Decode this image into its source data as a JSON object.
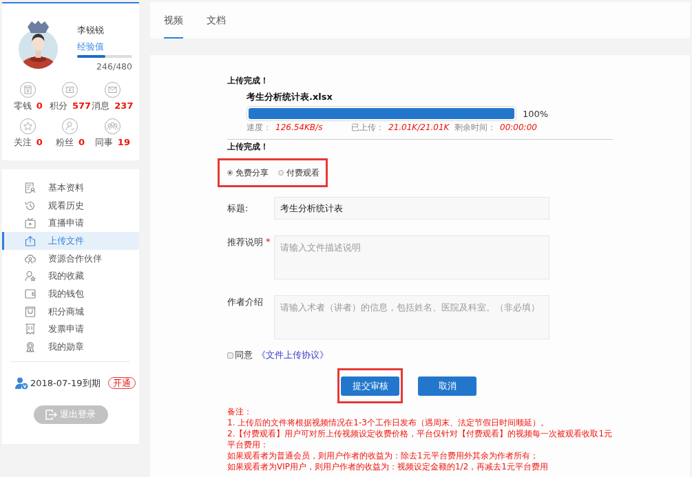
{
  "sidebar": {
    "profile": {
      "name": "李锐锐",
      "experience": {
        "label": "经验值",
        "level": 0.51,
        "reading": "246/480"
      }
    },
    "stats": [
      {
        "label": "零钱",
        "value": "0"
      },
      {
        "label": "积分",
        "value": "577"
      },
      {
        "label": "消息",
        "value": "237"
      },
      {
        "label": "关注",
        "value": "0"
      },
      {
        "label": "粉丝",
        "value": "0"
      },
      {
        "label": "同事",
        "value": "19"
      }
    ],
    "menu": [
      {
        "label": "基本资料",
        "selected": false
      },
      {
        "label": "观看历史",
        "selected": false
      },
      {
        "label": "直播申请",
        "selected": false
      },
      {
        "label": "上传文件",
        "selected": true
      },
      {
        "label": "资源合作伙伴",
        "selected": false
      },
      {
        "label": "我的收藏",
        "selected": false
      },
      {
        "label": "我的钱包",
        "selected": false
      },
      {
        "label": "积分商城",
        "selected": false
      },
      {
        "label": "发票申请",
        "selected": false
      },
      {
        "label": "我的勋章",
        "selected": false
      }
    ],
    "membership": {
      "expiry": "2018-07-19到期",
      "action": "开通"
    },
    "logout_button": "退出登录"
  },
  "tabs": [
    {
      "label": "视频",
      "selected": true
    },
    {
      "label": "文档",
      "selected": false
    }
  ],
  "upload": {
    "status": "上传完成！",
    "file_name": "考生分析统计表.xlsx",
    "level": 1,
    "percent": "100%",
    "stats": [
      {
        "label": "速度：",
        "value": "126.54KB/s"
      },
      {
        "label": "已上传：",
        "value": "21.01K/21.01K"
      },
      {
        "label": "剩余时间：",
        "value": "00:00:00"
      }
    ],
    "status_after": "上传完成！"
  },
  "access": {
    "highlighted": true,
    "options": [
      {
        "label": "免费分享",
        "selected": true
      },
      {
        "label": "付费观看",
        "selected": false
      }
    ]
  },
  "form": {
    "fields": [
      {
        "kind": "input",
        "label": "标题:",
        "value": "考生分析统计表"
      },
      {
        "kind": "textarea",
        "label": "推荐说明",
        "required_mark": "*",
        "placeholder": "请输入文件描述说明"
      },
      {
        "kind": "textarea",
        "label": "作者介绍",
        "placeholder": "请输入术者（讲者）的信息，包括姓名、医院及科室。（非必填）"
      }
    ],
    "agreement": {
      "checked": false,
      "label": "同意",
      "link": "《文件上传协议》"
    }
  },
  "buttons": [
    {
      "label": "提交审核",
      "highlighted": true
    },
    {
      "label": "取消",
      "highlighted": false
    }
  ],
  "notes": {
    "title": "备注：",
    "lines": [
      "1. 上传后的文件将根据视频情况在1-3个工作日发布（遇周末、法定节假日时间顺延）。",
      "2.【付费观看】用户可对所上传视频设定收费价格，平台仅针对【付费观看】的视频每一次被观看收取1元平台费用：",
      "如果观看者为普通会员，则用户作者的收益为：除去1元平台费用外其余为作者所有；",
      "如果观看者为VIP用户，则用户作者的收益为：视频设定金额的1/2，再减去1元平台费用"
    ]
  }
}
